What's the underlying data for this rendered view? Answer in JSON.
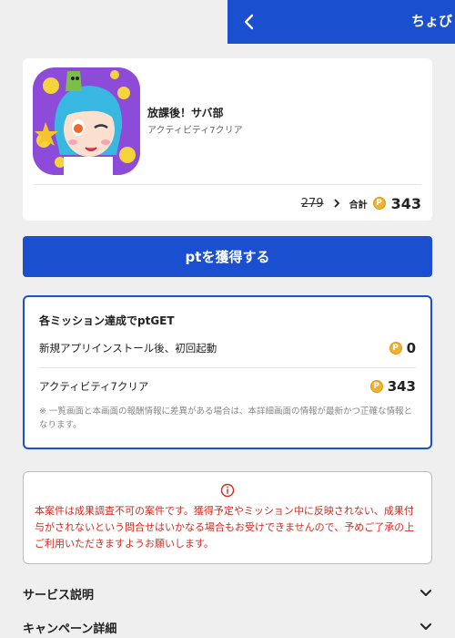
{
  "header": {
    "title": "ちょび",
    "back_icon": "chevron-left-icon"
  },
  "app": {
    "name": "放課後！サバ部",
    "subtitle": "アクティビティ7クリア",
    "old_points": "279",
    "total_label": "合計",
    "total_points": "343",
    "coin_symbol": "P"
  },
  "cta": {
    "label": "ptを獲得する"
  },
  "missions": {
    "heading": "各ミッション達成でptGET",
    "items": [
      {
        "label": "新規アプリインストール後、初回起動",
        "points": "0"
      },
      {
        "label": "アクティビティ7クリア",
        "points": "343"
      }
    ],
    "note": "※ 一覧画面と本画面の報酬情報に差異がある場合は、本詳細画面の情報が最新かつ正確な情報となります。"
  },
  "warning": {
    "icon": "info-icon",
    "text": "本案件は成果調査不可の案件です。獲得予定やミッション中に反映されない、成果付与がされないという問合せはいかなる場合もお受けできませんので、予めご了承の上ご利用いただきますようお願いします。"
  },
  "sections": [
    {
      "label": "サービス説明"
    },
    {
      "label": "キャンペーン詳細"
    }
  ],
  "colors": {
    "primary": "#1a4fcf",
    "warning_text": "#d42a1e",
    "coin": "#f2b230"
  }
}
